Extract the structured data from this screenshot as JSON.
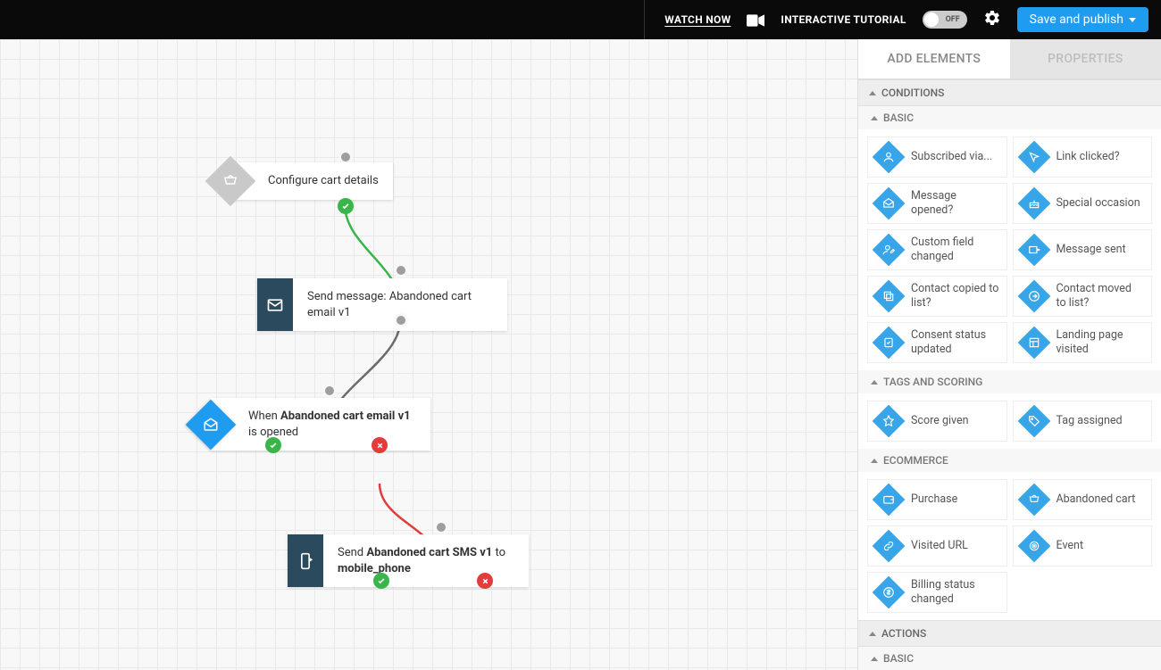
{
  "topbar": {
    "watch_now": "WATCH NOW",
    "tutorial_label": "INTERACTIVE TUTORIAL",
    "toggle_state": "OFF",
    "save_label": "Save and publish"
  },
  "nodes": {
    "configure": "Configure cart details",
    "send1_prefix": "Send message: ",
    "send1_name": "Abandoned cart email v1",
    "when_prefix": "When ",
    "when_name": "Abandoned cart email v1",
    "when_suffix": " is opened",
    "send2_prefix": "Send ",
    "send2_name": "Abandoned cart SMS v1",
    "send2_mid": " to ",
    "send2_target": "mobile_phone"
  },
  "panel": {
    "tab_add": "ADD ELEMENTS",
    "tab_props": "PROPERTIES",
    "conditions": "CONDITIONS",
    "basic": "BASIC",
    "tags_scoring": "TAGS AND SCORING",
    "ecommerce": "ECOMMERCE",
    "actions": "ACTIONS",
    "basic2": "BASIC",
    "items": {
      "subscribed": "Subscribed via...",
      "link_clicked": "Link clicked?",
      "msg_opened": "Message opened?",
      "special": "Special occasion",
      "custom_field": "Custom field changed",
      "msg_sent": "Message sent",
      "copied": "Contact copied to list?",
      "moved": "Contact moved to list?",
      "consent": "Consent status updated",
      "landing": "Landing page visited",
      "score": "Score given",
      "tag": "Tag assigned",
      "purchase": "Purchase",
      "abandoned": "Abandoned cart",
      "visited_url": "Visited URL",
      "event": "Event",
      "billing": "Billing status changed"
    }
  }
}
